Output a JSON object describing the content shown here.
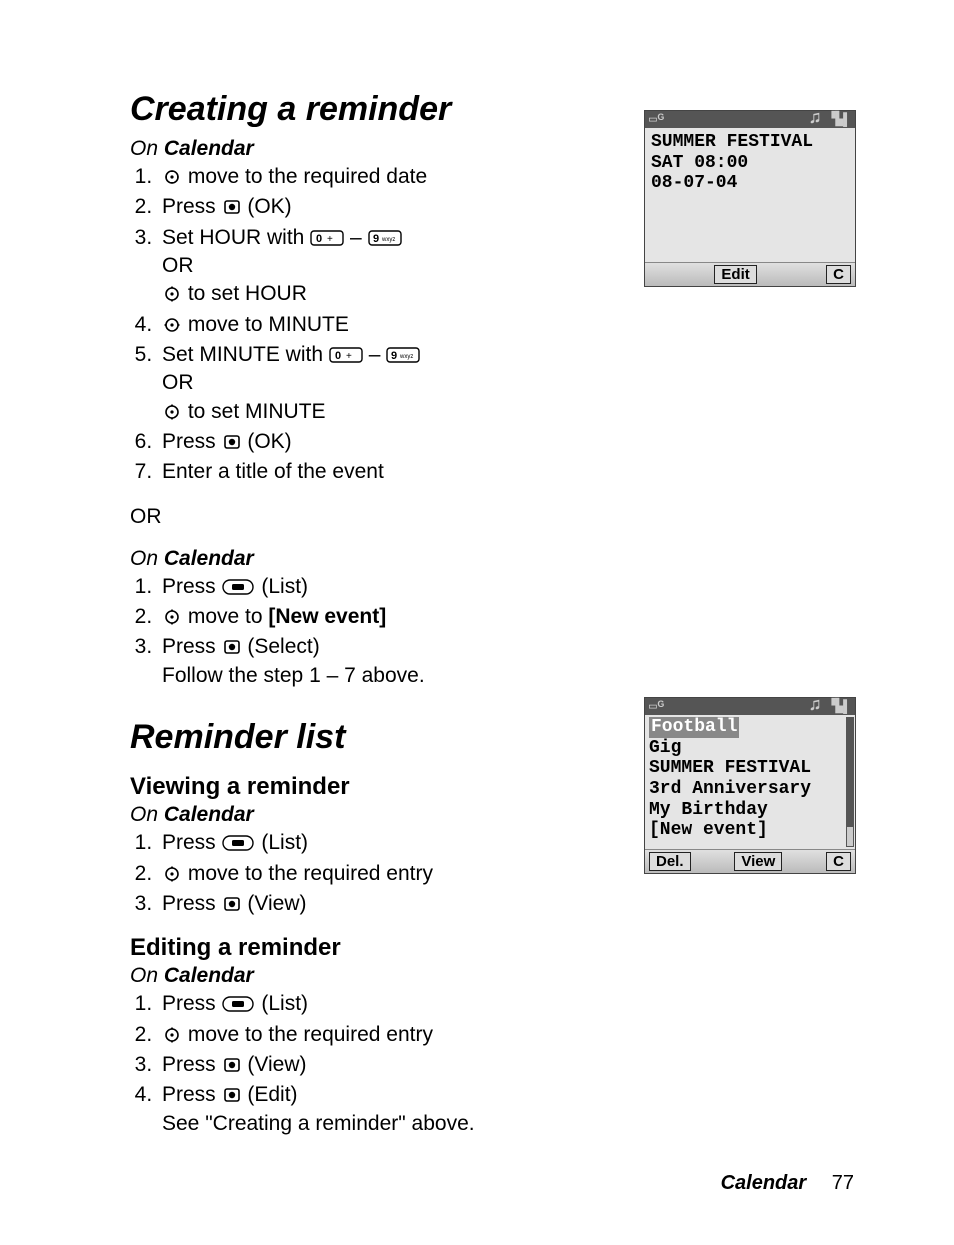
{
  "section1": {
    "heading": "Creating a reminder",
    "context_prefix": "On ",
    "context_bold": "Calendar",
    "steps_a": {
      "s1_after": " move to the required date",
      "s2_a": "Press ",
      "s2_b": " (OK)",
      "s3_a": "Set HOUR with ",
      "s3_dash": " – ",
      "s3_or": "OR",
      "s3_c": " to set HOUR",
      "s4_after": " move to MINUTE",
      "s5_a": "Set MINUTE with ",
      "s5_dash": " – ",
      "s5_or": "OR",
      "s5_c": " to set MINUTE",
      "s6_a": "Press ",
      "s6_b": " (OK)",
      "s7": "Enter a title of the event"
    },
    "or_label": "OR",
    "steps_b": {
      "s1_a": "Press ",
      "s1_b": " (List)",
      "s2_a": " move to ",
      "s2_bold": "[New event]",
      "s3_a": "Press ",
      "s3_b": " (Select)",
      "s3_follow": "Follow the step 1 – 7 above."
    }
  },
  "section2": {
    "heading": "Reminder list",
    "view": {
      "subheading": "Viewing a reminder",
      "s1_a": "Press ",
      "s1_b": " (List)",
      "s2_a": " move to the required entry",
      "s3_a": "Press ",
      "s3_b": " (View)"
    },
    "edit": {
      "subheading": "Editing a reminder",
      "s1_a": "Press ",
      "s1_b": " (List)",
      "s2_a": " move to the required entry",
      "s3_a": "Press ",
      "s3_b": " (View)",
      "s4_a": "Press ",
      "s4_b": " (Edit)",
      "s4_follow": "See \"Creating a reminder\" above."
    }
  },
  "phone1": {
    "title": "SUMMER FESTIVAL",
    "time": "SAT 08:00",
    "date": "08-07-04",
    "soft_center": "Edit",
    "soft_right": "C"
  },
  "phone2": {
    "items": [
      "Football",
      "Gig",
      "SUMMER FESTIVAL",
      "3rd Anniversary",
      "My Birthday",
      "[New event]"
    ],
    "soft_left": "Del.",
    "soft_center": "View",
    "soft_right": "C"
  },
  "footer": {
    "section": "Calendar",
    "page": "77"
  }
}
